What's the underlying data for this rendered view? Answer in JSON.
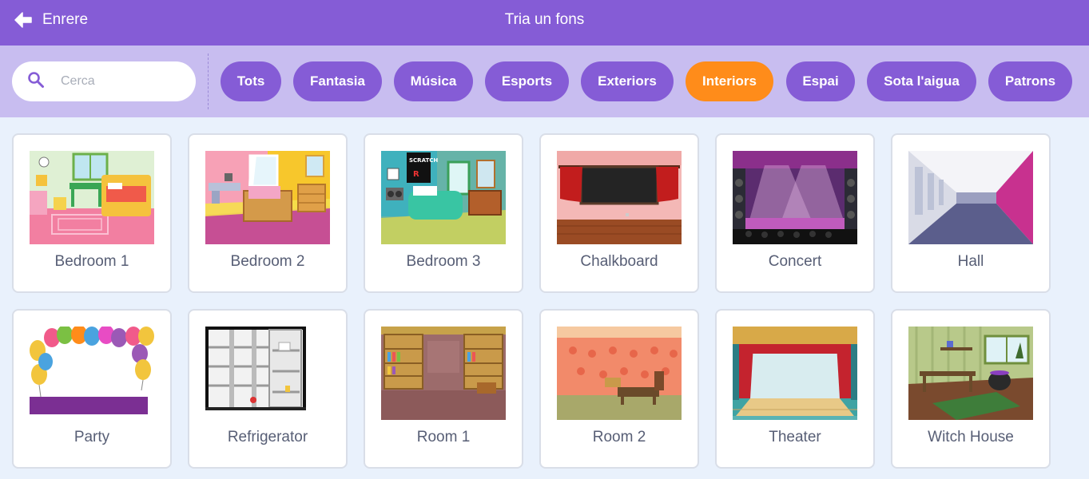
{
  "header": {
    "back_label": "Enrere",
    "title": "Tria un fons",
    "back_icon": "arrow-left-icon"
  },
  "search": {
    "placeholder": "Cerca",
    "value": "",
    "icon": "search-icon"
  },
  "tags": [
    {
      "label": "Tots",
      "active": false
    },
    {
      "label": "Fantasia",
      "active": false
    },
    {
      "label": "Música",
      "active": false
    },
    {
      "label": "Esports",
      "active": false
    },
    {
      "label": "Exteriors",
      "active": false
    },
    {
      "label": "Interiors",
      "active": true
    },
    {
      "label": "Espai",
      "active": false
    },
    {
      "label": "Sota l'aigua",
      "active": false
    },
    {
      "label": "Patrons",
      "active": false
    }
  ],
  "backdrops": [
    {
      "name": "Bedroom 1"
    },
    {
      "name": "Bedroom 2"
    },
    {
      "name": "Bedroom 3"
    },
    {
      "name": "Chalkboard"
    },
    {
      "name": "Concert"
    },
    {
      "name": "Hall"
    },
    {
      "name": "Party"
    },
    {
      "name": "Refrigerator"
    },
    {
      "name": "Room 1"
    },
    {
      "name": "Room 2"
    },
    {
      "name": "Theater"
    },
    {
      "name": "Witch House"
    }
  ],
  "colors": {
    "header_bg": "#855cd6",
    "filter_bg": "#c8bdf0",
    "tag_bg": "#855cd6",
    "tag_active_bg": "#ff8c1a",
    "page_bg": "#e9f1fc"
  }
}
